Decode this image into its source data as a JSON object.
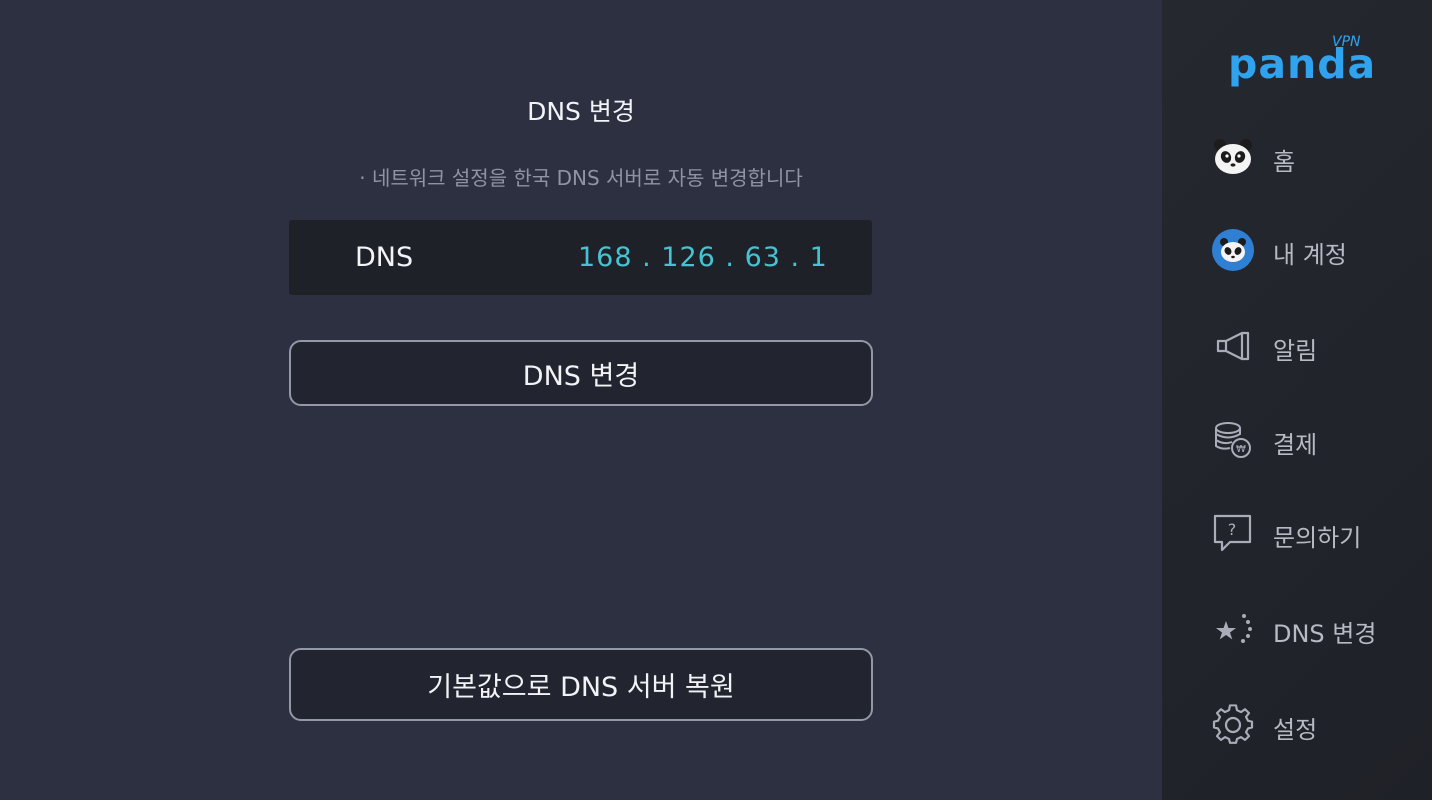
{
  "main": {
    "title": "DNS 변경",
    "subtitle": "· 네트워크 설정을 한국 DNS 서버로 자동 변경합니다",
    "dns_label": "DNS",
    "dns_value": "168 . 126 . 63 . 1",
    "change_button": "DNS 변경",
    "restore_button": "기본값으로 DNS 서버 복원"
  },
  "sidebar": {
    "logo": "panda",
    "logo_sup": "VPN",
    "items": [
      {
        "label": "홈",
        "icon": "panda-face-icon"
      },
      {
        "label": "내 계정",
        "icon": "account-avatar-icon"
      },
      {
        "label": "알림",
        "icon": "megaphone-icon"
      },
      {
        "label": "결제",
        "icon": "coins-won-icon"
      },
      {
        "label": "문의하기",
        "icon": "question-bubble-icon"
      },
      {
        "label": "DNS 변경",
        "icon": "star-dots-icon"
      },
      {
        "label": "설정",
        "icon": "gear-icon"
      }
    ]
  },
  "colors": {
    "accent": "#2fa3ee",
    "dns_value": "#46c3d3",
    "background": "#2d3040",
    "sidebar": "#23252d"
  }
}
